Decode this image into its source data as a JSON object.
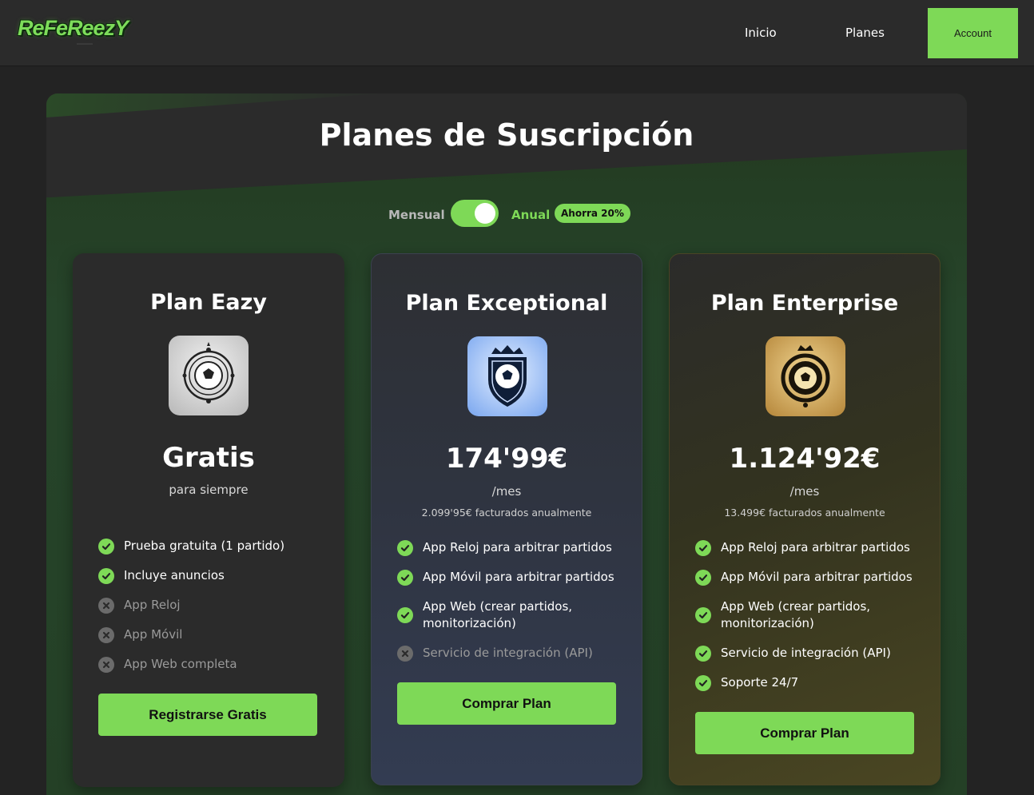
{
  "nav": {
    "logo": "ReFeReezY",
    "links": [
      "Inicio",
      "Planes"
    ],
    "account_label": "Account"
  },
  "page": {
    "title": "Planes de Suscripción"
  },
  "billing_toggle": {
    "monthly_label": "Mensual",
    "annual_label": "Anual",
    "save_badge": "Ahorra 20%",
    "selected": "Anual"
  },
  "plans": [
    {
      "name": "Plan Eazy",
      "icon": "soccer-ball-compass-icon",
      "price": "Gratis",
      "period": "para siempre",
      "billing_note": "",
      "features": [
        {
          "text": "Prueba gratuita (1 partido)",
          "included": true
        },
        {
          "text": "Incluye anuncios",
          "included": true
        },
        {
          "text": "App Reloj",
          "included": false
        },
        {
          "text": "App Móvil",
          "included": false
        },
        {
          "text": "App Web completa",
          "included": false
        }
      ],
      "button": "Registrarse Gratis"
    },
    {
      "name": "Plan Exceptional",
      "icon": "soccer-shield-crown-icon",
      "price": "174'99€",
      "period": "/mes",
      "billing_note": "2.099'95€ facturados anualmente",
      "features": [
        {
          "text": "App Reloj para arbitrar partidos",
          "included": true
        },
        {
          "text": "App Móvil para arbitrar partidos",
          "included": true
        },
        {
          "text": "App Web (crear partidos, monitorización)",
          "included": true
        },
        {
          "text": "Servicio de integración (API)",
          "included": false
        }
      ],
      "button": "Comprar Plan"
    },
    {
      "name": "Plan Enterprise",
      "icon": "soccer-laurel-crown-icon",
      "price": "1.124'92€",
      "period": "/mes",
      "billing_note": "13.499€ facturados anualmente",
      "features": [
        {
          "text": "App Reloj para arbitrar partidos",
          "included": true
        },
        {
          "text": "App Móvil para arbitrar partidos",
          "included": true
        },
        {
          "text": "App Web (crear partidos, monitorización)",
          "included": true
        },
        {
          "text": "Servicio de integración (API)",
          "included": true
        },
        {
          "text": "Soporte 24/7",
          "included": true
        }
      ],
      "button": "Comprar Plan"
    }
  ],
  "colors": {
    "accent": "#7ed957",
    "background": "#232323",
    "card": "#2b2b2b"
  }
}
